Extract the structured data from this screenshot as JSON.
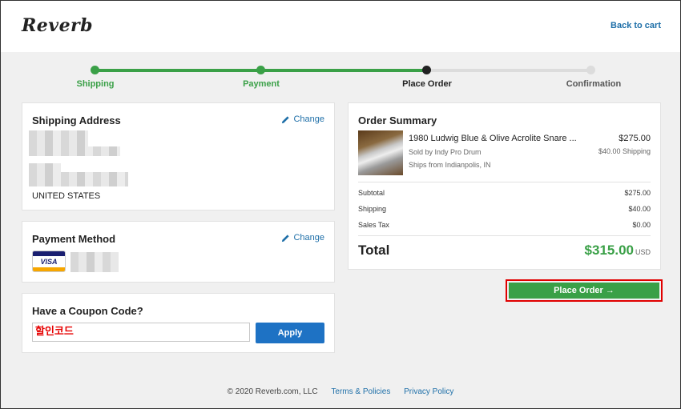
{
  "header": {
    "logo": "Reverb",
    "back_link": "Back to cart"
  },
  "steps": [
    {
      "label": "Shipping",
      "state": "done"
    },
    {
      "label": "Payment",
      "state": "done"
    },
    {
      "label": "Place Order",
      "state": "current"
    },
    {
      "label": "Confirmation",
      "state": "pending"
    }
  ],
  "colors": {
    "accent_green": "#3aa047",
    "link_blue": "#1e6fa8",
    "button_blue": "#1e72c4",
    "highlight_red": "#e00000"
  },
  "shipping": {
    "title": "Shipping Address",
    "change": "Change",
    "country": "UNITED STATES"
  },
  "payment": {
    "title": "Payment Method",
    "change": "Change",
    "card_brand": "VISA"
  },
  "coupon": {
    "title": "Have a Coupon Code?",
    "value": "할인코드",
    "apply": "Apply"
  },
  "summary": {
    "title": "Order Summary",
    "item": {
      "name": "1980 Ludwig Blue & Olive Acrolite Snare ...",
      "price": "$275.00",
      "shipping_note": "$40.00 Shipping",
      "seller": "Sold by Indy Pro Drum",
      "ships_from": "Ships from Indianpolis, IN"
    },
    "rows": [
      {
        "label": "Subtotal",
        "value": "$275.00"
      },
      {
        "label": "Shipping",
        "value": "$40.00"
      },
      {
        "label": "Sales Tax",
        "value": "$0.00"
      }
    ],
    "total_label": "Total",
    "total_value": "$315.00",
    "currency": "USD"
  },
  "place_order": "Place Order →",
  "footer": {
    "copyright": "© 2020 Reverb.com, LLC",
    "terms": "Terms & Policies",
    "privacy": "Privacy Policy"
  }
}
